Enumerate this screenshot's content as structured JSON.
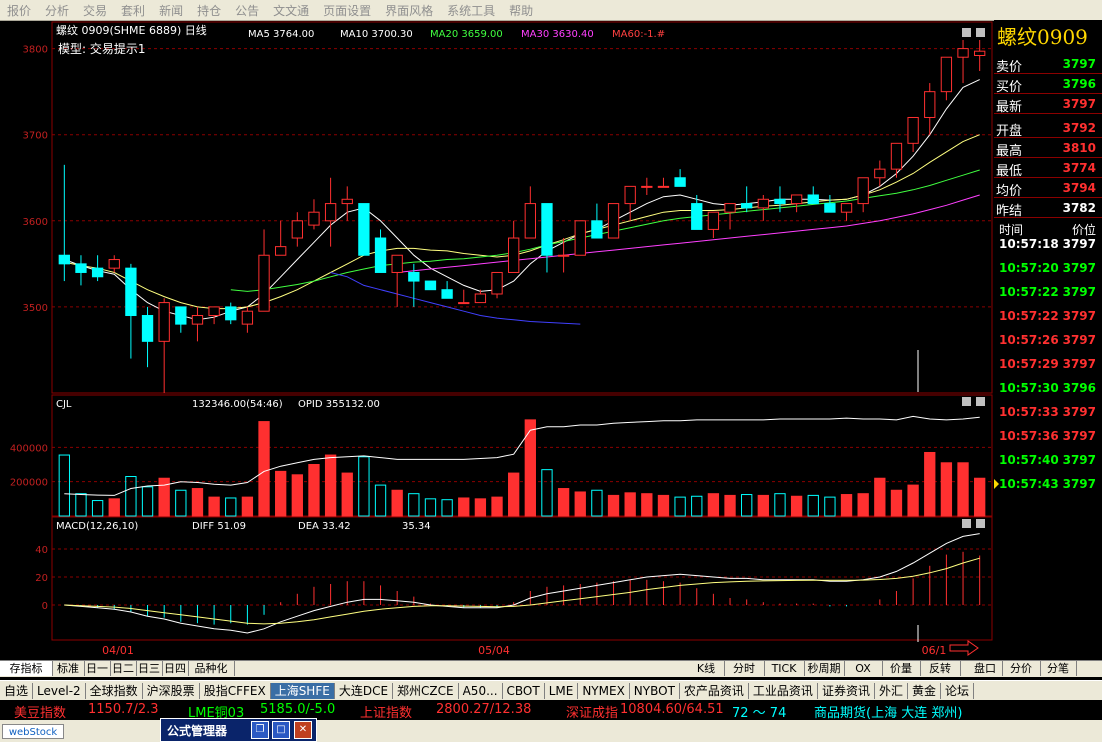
{
  "menu": [
    "报价",
    "分析",
    "交易",
    "套利",
    "新闻",
    "持仓",
    "公告",
    "文文通",
    "页面设置",
    "界面风格",
    "系统工具",
    "帮助"
  ],
  "chart_header": {
    "symbol": "螺纹 0909(SHME 6889) 日线",
    "ma5": "MA5 3764.00",
    "ma10": "MA10 3700.30",
    "ma20": "MA20 3659.00",
    "ma30": "MA30 3630.40",
    "ma60": "MA60:-1.#",
    "model": "模型:  交易提示1"
  },
  "colors": {
    "up": "#ff3030",
    "down": "#00ffff",
    "ma5": "#ffffff",
    "ma10": "#ffff80",
    "ma20": "#40ff40",
    "ma30": "#ff40ff",
    "ma60": "#4040ff",
    "grid": "#8b0000",
    "panel": "#8b0000"
  },
  "chart_data": [
    {
      "type": "candlestick",
      "y_ticks": [
        "3800",
        "3700",
        "3600",
        "3500"
      ],
      "ylim": [
        3400,
        3810
      ],
      "x_labels": [
        "04/01",
        "05/04",
        "06/1"
      ],
      "candles": [
        [
          3560,
          3665,
          3530,
          3550
        ],
        [
          3550,
          3560,
          3525,
          3540
        ],
        [
          3545,
          3560,
          3530,
          3535
        ],
        [
          3545,
          3560,
          3540,
          3555
        ],
        [
          3545,
          3550,
          3440,
          3490
        ],
        [
          3490,
          3500,
          3430,
          3460
        ],
        [
          3460,
          3510,
          3400,
          3505
        ],
        [
          3500,
          3500,
          3470,
          3480
        ],
        [
          3480,
          3500,
          3460,
          3490
        ],
        [
          3490,
          3500,
          3480,
          3500
        ],
        [
          3500,
          3505,
          3480,
          3485
        ],
        [
          3480,
          3500,
          3470,
          3495
        ],
        [
          3495,
          3590,
          3495,
          3560
        ],
        [
          3560,
          3600,
          3560,
          3570
        ],
        [
          3580,
          3610,
          3570,
          3600
        ],
        [
          3595,
          3625,
          3590,
          3610
        ],
        [
          3600,
          3650,
          3570,
          3620
        ],
        [
          3620,
          3640,
          3600,
          3625
        ],
        [
          3620,
          3590,
          3580,
          3560
        ],
        [
          3580,
          3590,
          3560,
          3540
        ],
        [
          3540,
          3560,
          3500,
          3560
        ],
        [
          3540,
          3550,
          3500,
          3530
        ],
        [
          3530,
          3530,
          3520,
          3520
        ],
        [
          3520,
          3530,
          3510,
          3510
        ],
        [
          3505,
          3520,
          3505,
          3505
        ],
        [
          3505,
          3520,
          3505,
          3515
        ],
        [
          3515,
          3540,
          3510,
          3540
        ],
        [
          3540,
          3600,
          3540,
          3580
        ],
        [
          3580,
          3640,
          3580,
          3620
        ],
        [
          3620,
          3620,
          3540,
          3560
        ],
        [
          3560,
          3580,
          3540,
          3560
        ],
        [
          3560,
          3600,
          3560,
          3600
        ],
        [
          3600,
          3620,
          3580,
          3580
        ],
        [
          3580,
          3620,
          3580,
          3620
        ],
        [
          3620,
          3640,
          3600,
          3640
        ],
        [
          3640,
          3650,
          3630,
          3640
        ],
        [
          3640,
          3650,
          3640,
          3640
        ],
        [
          3650,
          3660,
          3640,
          3640
        ],
        [
          3620,
          3630,
          3600,
          3590
        ],
        [
          3590,
          3600,
          3580,
          3610
        ],
        [
          3610,
          3620,
          3590,
          3620
        ],
        [
          3620,
          3640,
          3610,
          3615
        ],
        [
          3615,
          3630,
          3600,
          3625
        ],
        [
          3625,
          3640,
          3610,
          3620
        ],
        [
          3620,
          3630,
          3610,
          3630
        ],
        [
          3630,
          3640,
          3620,
          3620
        ],
        [
          3620,
          3630,
          3610,
          3610
        ],
        [
          3610,
          3620,
          3600,
          3620
        ],
        [
          3620,
          3640,
          3610,
          3650
        ],
        [
          3650,
          3670,
          3640,
          3660
        ],
        [
          3660,
          3680,
          3650,
          3690
        ],
        [
          3690,
          3720,
          3680,
          3720
        ],
        [
          3720,
          3760,
          3700,
          3750
        ],
        [
          3750,
          3790,
          3740,
          3790
        ],
        [
          3790,
          3810,
          3760,
          3800
        ],
        [
          3792,
          3810,
          3774,
          3797
        ]
      ],
      "ma_series": {
        "ma5": [
          3555,
          3548,
          3542,
          3538,
          3520,
          3505,
          3495,
          3490,
          3485,
          3488,
          3495,
          3500,
          3515,
          3535,
          3555,
          3575,
          3595,
          3610,
          3615,
          3600,
          3580,
          3560,
          3545,
          3535,
          3525,
          3518,
          3520,
          3530,
          3550,
          3565,
          3575,
          3585,
          3590,
          3600,
          3610,
          3620,
          3628,
          3630,
          3625,
          3620,
          3618,
          3620,
          3622,
          3625,
          3625,
          3625,
          3624,
          3625,
          3630,
          3640,
          3655,
          3675,
          3700,
          3730,
          3755,
          3764
        ],
        "ma10": [
          3552,
          3548,
          3545,
          3540,
          3530,
          3520,
          3512,
          3505,
          3500,
          3498,
          3498,
          3500,
          3505,
          3512,
          3520,
          3530,
          3540,
          3550,
          3560,
          3565,
          3568,
          3568,
          3566,
          3565,
          3562,
          3560,
          3558,
          3560,
          3565,
          3572,
          3578,
          3585,
          3590,
          3595,
          3600,
          3605,
          3610,
          3612,
          3612,
          3612,
          3613,
          3615,
          3617,
          3618,
          3620,
          3622,
          3624,
          3625,
          3630,
          3636,
          3645,
          3655,
          3668,
          3680,
          3692,
          3700
        ],
        "ma20": [
          null,
          null,
          null,
          null,
          null,
          null,
          null,
          null,
          null,
          null,
          3520,
          3518,
          3520,
          3523,
          3526,
          3530,
          3535,
          3540,
          3544,
          3548,
          3550,
          3552,
          3553,
          3555,
          3556,
          3558,
          3560,
          3563,
          3567,
          3572,
          3576,
          3580,
          3584,
          3588,
          3592,
          3596,
          3600,
          3603,
          3605,
          3607,
          3609,
          3611,
          3613,
          3615,
          3617,
          3619,
          3621,
          3623,
          3626,
          3629,
          3632,
          3636,
          3641,
          3647,
          3653,
          3659
        ],
        "ma30": [
          null,
          null,
          null,
          null,
          null,
          null,
          null,
          null,
          null,
          null,
          null,
          null,
          null,
          null,
          null,
          null,
          null,
          null,
          null,
          null,
          3540,
          3542,
          3544,
          3546,
          3548,
          3550,
          3552,
          3554,
          3556,
          3558,
          3560,
          3562,
          3564,
          3566,
          3568,
          3570,
          3572,
          3574,
          3576,
          3578,
          3580,
          3582,
          3584,
          3586,
          3588,
          3590,
          3592,
          3594,
          3597,
          3600,
          3604,
          3608,
          3613,
          3618,
          3624,
          3630
        ],
        "ma60": [
          null,
          null,
          null,
          null,
          null,
          null,
          null,
          null,
          null,
          null,
          null,
          null,
          null,
          null,
          null,
          null,
          3540,
          3535,
          3525,
          3520,
          3515,
          3510,
          3505,
          3500,
          3495,
          3490,
          3487,
          3485,
          3483,
          3482,
          3481,
          3480
        ]
      }
    },
    {
      "type": "bar",
      "title": "CJL",
      "label": "132346.00(54:46)",
      "opid": "OPID  355132.00",
      "y_ticks": [
        "400000",
        "200000"
      ],
      "ylim": [
        0,
        600000
      ],
      "volume": [
        355132,
        130000,
        90000,
        100000,
        230000,
        170000,
        220000,
        150000,
        160000,
        110000,
        105000,
        110000,
        550000,
        260000,
        240000,
        300000,
        355000,
        250000,
        345000,
        180000,
        150000,
        130000,
        100000,
        95000,
        105000,
        100000,
        110000,
        250000,
        560000,
        270000,
        160000,
        140000,
        150000,
        120000,
        135000,
        130000,
        120000,
        110000,
        115000,
        130000,
        120000,
        125000,
        120000,
        130000,
        115000,
        120000,
        110000,
        125000,
        130000,
        220000,
        150000,
        180000,
        370000,
        310000,
        310000,
        220000
      ],
      "opid_series": [
        130000,
        125000,
        122000,
        120000,
        160000,
        175000,
        180000,
        200000,
        195000,
        185000,
        180000,
        195000,
        260000,
        290000,
        310000,
        330000,
        340000,
        345000,
        350000,
        340000,
        330000,
        330000,
        330000,
        330000,
        330000,
        335000,
        340000,
        360000,
        500000,
        520000,
        520000,
        530000,
        530000,
        540000,
        545000,
        550000,
        555000,
        555000,
        560000,
        560000,
        560000,
        560000,
        560000,
        565000,
        565000,
        565000,
        565000,
        570000,
        565000,
        565000,
        560000,
        580000,
        565000,
        560000,
        565000,
        575000
      ]
    },
    {
      "type": "line",
      "title": "MACD(12,26,10)",
      "diff": "DIFF  51.09",
      "dea": "DEA  33.42",
      "macd": "35.34",
      "y_ticks": [
        "40",
        "20",
        "0"
      ],
      "ylim": [
        -25,
        50
      ],
      "diff_series": [
        0,
        -1,
        -2,
        -3,
        -5,
        -8,
        -10,
        -13,
        -15,
        -17,
        -18,
        -20,
        -17,
        -12,
        -8,
        -4,
        -1,
        2,
        4,
        4,
        3,
        2,
        0,
        -1,
        -2,
        -2,
        -2,
        0,
        5,
        8,
        10,
        12,
        14,
        16,
        18,
        20,
        21,
        22,
        21,
        20,
        19,
        19,
        18,
        18,
        18,
        18,
        17,
        17,
        18,
        20,
        24,
        30,
        37,
        44,
        49,
        51
      ],
      "dea_series": [
        0,
        -0.5,
        -1,
        -1.5,
        -2.5,
        -4,
        -5.5,
        -7,
        -8.5,
        -10,
        -11.5,
        -13,
        -13.5,
        -13,
        -12,
        -10.5,
        -8.5,
        -6.5,
        -4.5,
        -3,
        -2,
        -1,
        -0.5,
        -0.5,
        -0.8,
        -1,
        -1.2,
        -1,
        0,
        1.5,
        3,
        4.5,
        6,
        7.5,
        9,
        11,
        12.5,
        14,
        15,
        16,
        16.5,
        17,
        17.2,
        17.4,
        17.6,
        17.7,
        17.7,
        17.7,
        17.8,
        18.2,
        19,
        20.5,
        23,
        26,
        30,
        33.42
      ],
      "macd_series": [
        0,
        -1,
        -2,
        -3,
        -5,
        -8,
        -9,
        -12,
        -13,
        -14,
        -13,
        -14,
        -7,
        2,
        8,
        13,
        15,
        17,
        17,
        14,
        10,
        6,
        1,
        -1,
        -2,
        -2,
        -2,
        2,
        10,
        13,
        14,
        15,
        16,
        17,
        18,
        18,
        17,
        16,
        12,
        8,
        5,
        4,
        2,
        1,
        1,
        1,
        -1,
        -1,
        0,
        4,
        10,
        19,
        28,
        36,
        38,
        35.34
      ]
    }
  ],
  "quote_panel": {
    "title": "螺纹0909",
    "rows": [
      {
        "label": "卖价",
        "value": "3797",
        "color": "#00ff00"
      },
      {
        "label": "买价",
        "value": "3796",
        "color": "#00ff00"
      },
      {
        "label": "最新",
        "value": "3797",
        "color": "#ff3030"
      },
      {
        "label": "开盘",
        "value": "3792",
        "color": "#ff3030"
      },
      {
        "label": "最高",
        "value": "3810",
        "color": "#ff3030"
      },
      {
        "label": "最低",
        "value": "3774",
        "color": "#ff3030"
      },
      {
        "label": "均价",
        "value": "3794",
        "color": "#ff3030"
      },
      {
        "label": "昨结",
        "value": "3782",
        "color": "#ffffff"
      }
    ],
    "ticks_header": {
      "time": "时间",
      "price": "价位"
    },
    "ticks": [
      {
        "time": "10:57:18",
        "price": "3797",
        "color": "#ffffff"
      },
      {
        "time": "10:57:20",
        "price": "3797",
        "color": "#00ff00"
      },
      {
        "time": "10:57:22",
        "price": "3797",
        "color": "#00ff00"
      },
      {
        "time": "10:57:22",
        "price": "3797",
        "color": "#ff3030"
      },
      {
        "time": "10:57:26",
        "price": "3797",
        "color": "#ff3030"
      },
      {
        "time": "10:57:29",
        "price": "3797",
        "color": "#ff3030"
      },
      {
        "time": "10:57:30",
        "price": "3796",
        "color": "#00ff00"
      },
      {
        "time": "10:57:33",
        "price": "3797",
        "color": "#ff3030"
      },
      {
        "time": "10:57:36",
        "price": "3797",
        "color": "#ff3030"
      },
      {
        "time": "10:57:40",
        "price": "3797",
        "color": "#00ff00"
      },
      {
        "time": "10:57:43",
        "price": "3797",
        "color": "#00ff00"
      }
    ]
  },
  "tab_strip": {
    "left": [
      "存指标",
      "标准",
      "日一",
      "日二",
      "日三",
      "日四",
      "品种化"
    ],
    "right": [
      "K线",
      "分时",
      "TICK",
      "秒周期",
      "OX",
      "价量",
      "反转",
      "盘口",
      "分价",
      "分笔"
    ]
  },
  "market_bar": [
    "自选",
    "Level-2",
    "全球指数",
    "沪深股票",
    "股指CFFEX",
    "上海SHFE",
    "大连DCE",
    "郑州CZCE",
    "A50...",
    "CBOT",
    "LME",
    "NYMEX",
    "NYBOT",
    "农产品资讯",
    "工业品资讯",
    "证券资讯",
    "外汇",
    "黄金",
    "论坛"
  ],
  "market_active": "上海SHFE",
  "ticker": [
    {
      "text": "美豆指数",
      "color": "#ff3030"
    },
    {
      "text": "1150.7/2.3",
      "color": "#ff3030"
    },
    {
      "text": "LME铜03",
      "color": "#00ff00"
    },
    {
      "text": "5185.0/-5.0",
      "color": "#00ff00"
    },
    {
      "text": "上证指数",
      "color": "#ff3030"
    },
    {
      "text": "2800.27/12.38",
      "color": "#ff3030"
    },
    {
      "text": "深证成指",
      "color": "#ff3030"
    },
    {
      "text": "10804.60/64.51",
      "color": "#ff3030"
    },
    {
      "text": "72 ～ 74",
      "color": "#00ffff"
    },
    {
      "text": "商品期货(上海 大连 郑州)",
      "color": "#00ffff"
    }
  ],
  "taskbar": {
    "logo": "webStock",
    "window_title": "公式管理器"
  }
}
